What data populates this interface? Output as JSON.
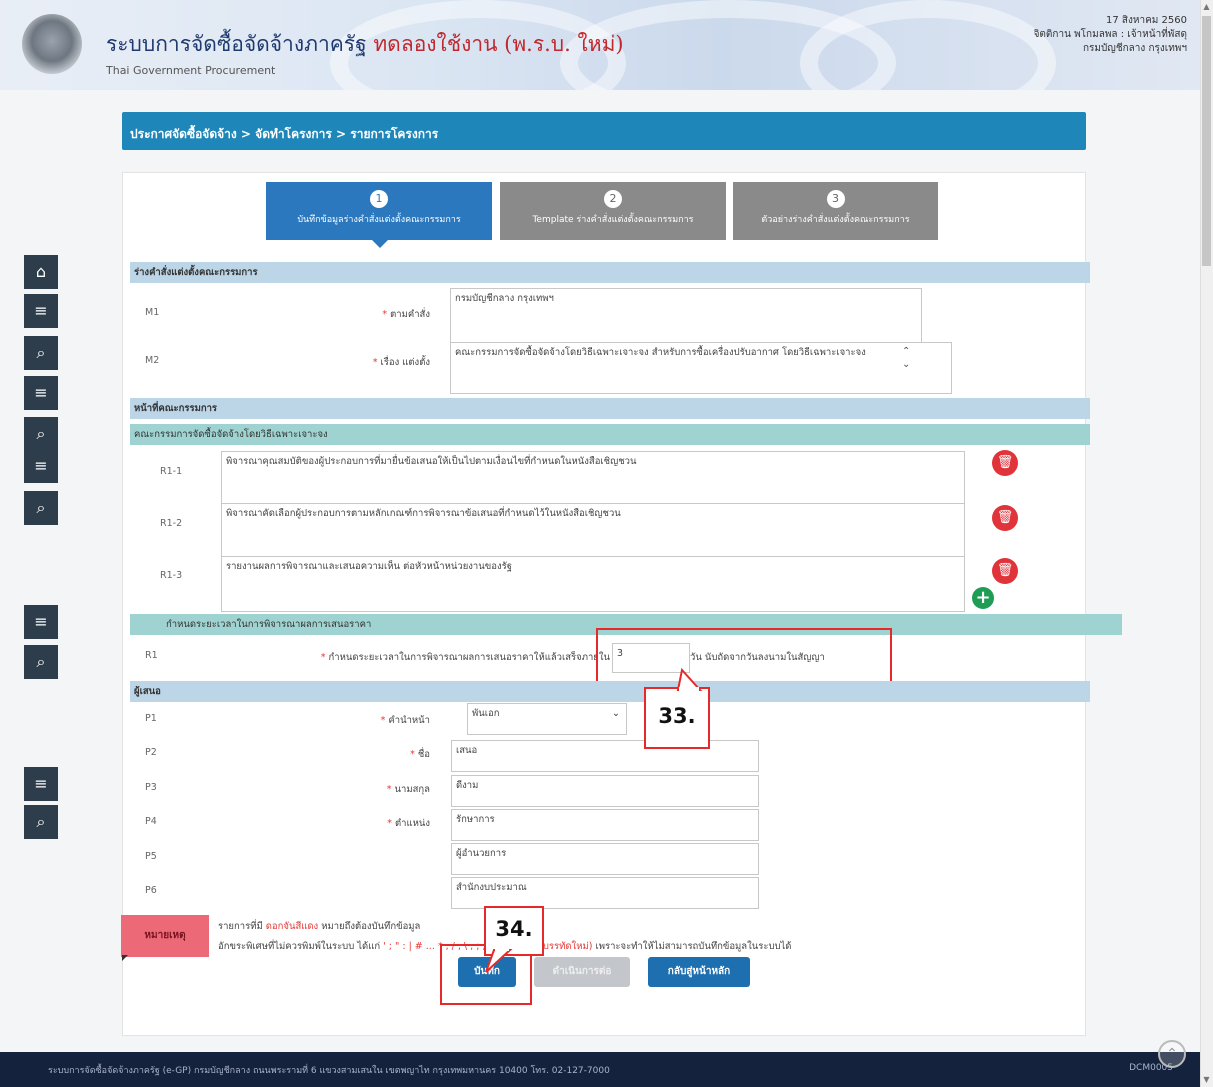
{
  "header": {
    "title_main": "ระบบการจัดซื้อจัดจ้างภาครัฐ",
    "title_trial": "ทดลองใช้งาน (พ.ร.บ. ใหม่)",
    "subtitle": "Thai Government Procurement",
    "date": "17 สิงหาคม 2560",
    "user": "จิตติกาน พโกมลพล : เจ้าหน้าที่พัสดุ",
    "department": "กรมบัญชีกลาง กรุงเทพฯ"
  },
  "breadcrumb": "ประกาศจัดซื้อจัดจ้าง > จัดทำโครงการ > รายการโครงการ",
  "steps": [
    {
      "num": "1",
      "label": "บันทึกข้อมูลร่างคำสั่งแต่งตั้งคณะกรรมการ"
    },
    {
      "num": "2",
      "label": "Template ร่างคำสั่งแต่งตั้งคณะกรรมการ"
    },
    {
      "num": "3",
      "label": "ตัวอย่างร่างคำสั่งแต่งตั้งคณะกรรมการ"
    }
  ],
  "sections": {
    "order": "ร่างคำสั่งแต่งตั้งคณะกรรมการ",
    "duties": "หน้าที่คณะกรรมการ",
    "committee": "คณะกรรมการจัดซื้อจัดจ้างโดยวิธีเฉพาะเจาะจง",
    "deadline": "กำหนดระยะเวลาในการพิจารณาผลการเสนอราคา",
    "proposer": "ผู้เสนอ"
  },
  "order_fields": [
    {
      "code": "M1",
      "label": "ตามคำสั่ง",
      "value": "กรมบัญชีกลาง กรุงเทพฯ"
    },
    {
      "code": "M2",
      "label": "เรื่อง แต่งตั้ง",
      "value": "คณะกรรมการจัดซื้อจัดจ้างโดยวิธีเฉพาะเจาะจง สำหรับการซื้อเครื่องปรับอากาศ โดยวิธีเฉพาะเจาะจง"
    }
  ],
  "duty_rows": [
    {
      "code": "R1-1",
      "value": "พิจารณาคุณสมบัติของผู้ประกอบการที่มายื่นข้อเสนอให้เป็นไปตามเงื่อนไขที่กำหนดในหนังสือเชิญชวน"
    },
    {
      "code": "R1-2",
      "value": "พิจารณาคัดเลือกผู้ประกอบการตามหลักเกณฑ์การพิจารณาข้อเสนอที่กำหนดไว้ในหนังสือเชิญชวน"
    },
    {
      "code": "R1-3",
      "value": "รายงานผลการพิจารณาและเสนอความเห็น ต่อหัวหน้าหน่วยงานของรัฐ"
    }
  ],
  "deadline": {
    "code": "R1",
    "label": "กำหนดระยะเวลาในการพิจารณาผลการเสนอราคาให้แล้วเสร็จภายใน",
    "value": "3",
    "unit": "วัน นับถัดจากวันลงนามในสัญญา"
  },
  "proposer_fields": [
    {
      "code": "P1",
      "label": "คำนำหน้า",
      "value": "พันเอก",
      "required": true
    },
    {
      "code": "P2",
      "label": "ชื่อ",
      "value": "เสนอ",
      "required": true
    },
    {
      "code": "P3",
      "label": "นามสกุล",
      "value": "ดีงาม",
      "required": true
    },
    {
      "code": "P4",
      "label": "ตำแหน่ง",
      "value": "รักษาการ",
      "required": true
    },
    {
      "code": "P5",
      "label": "",
      "value": "ผู้อำนวยการ",
      "required": false
    },
    {
      "code": "P6",
      "label": "",
      "value": "สำนักงบประมาณ",
      "required": false
    }
  ],
  "note": {
    "tag": "หมายเหตุ",
    "line1_prefix": "รายการที่มี",
    "line1_highlight": "ดอกจันสีแดง",
    "line1_suffix": "หมายถึงต้องบันทึกข้อมูล",
    "line2_prefix": "อักขระพิเศษที่ไม่ควรพิมพ์ในระบบ ได้แก่",
    "line2_chars": "' ; \" : | # ... * , / , \\ , ; , ; ENTER(ขึ้นบรรทัดใหม่)",
    "line2_suffix": "เพราะจะทำให้ไม่สามารถบันทึกข้อมูลในระบบได้"
  },
  "buttons": {
    "save": "บันทึก",
    "disabled": "ดำเนินการต่อ",
    "back": "กลับสู่หน้าหลัก"
  },
  "callouts": {
    "c33": "33.",
    "c34": "34."
  },
  "footer": {
    "text": "ระบบการจัดซื้อจัดจ้างภาครัฐ (e-GP) กรมบัญชีกลาง ถนนพระรามที่ 6 แขวงสามเสนใน เขตพญาไท กรุงเทพมหานคร 10400 โทร. 02-127-7000",
    "code": "DCM0005"
  },
  "colors": {
    "brand": "#1e86b9",
    "step_active": "#2b78bf",
    "step_inactive": "#8a8a8a",
    "callout_red": "#e62a2a"
  }
}
